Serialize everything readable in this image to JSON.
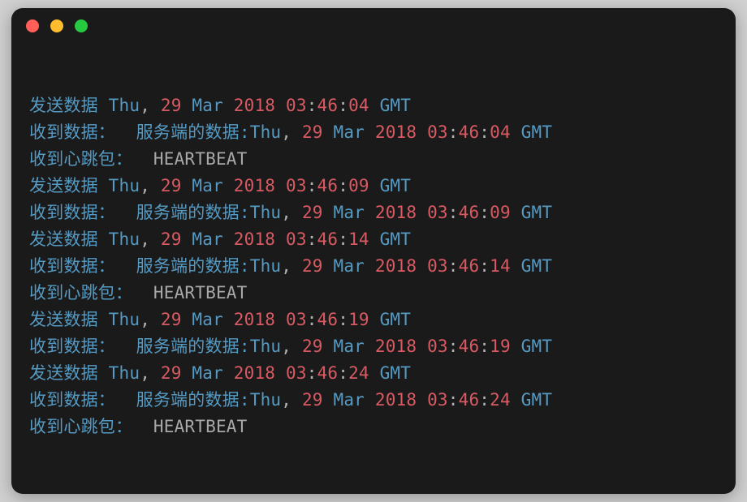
{
  "lines": [
    {
      "tokens": [
        {
          "cls": "cn",
          "text": "发送数据 "
        },
        {
          "cls": "cn",
          "text": "Thu"
        },
        {
          "cls": "punct",
          "text": ", "
        },
        {
          "cls": "num",
          "text": "29"
        },
        {
          "cls": "cn",
          "text": " Mar "
        },
        {
          "cls": "num",
          "text": "2018"
        },
        {
          "cls": "cn",
          "text": " "
        },
        {
          "cls": "num",
          "text": "03"
        },
        {
          "cls": "colon",
          "text": ":"
        },
        {
          "cls": "num",
          "text": "46"
        },
        {
          "cls": "colon",
          "text": ":"
        },
        {
          "cls": "num",
          "text": "04"
        },
        {
          "cls": "cn",
          "text": " GMT"
        }
      ]
    },
    {
      "tokens": [
        {
          "cls": "cn",
          "text": "收到数据：  服务端的数据:"
        },
        {
          "cls": "cn",
          "text": "Thu"
        },
        {
          "cls": "punct",
          "text": ", "
        },
        {
          "cls": "num",
          "text": "29"
        },
        {
          "cls": "cn",
          "text": " Mar "
        },
        {
          "cls": "num",
          "text": "2018"
        },
        {
          "cls": "cn",
          "text": " "
        },
        {
          "cls": "num",
          "text": "03"
        },
        {
          "cls": "colon",
          "text": ":"
        },
        {
          "cls": "num",
          "text": "46"
        },
        {
          "cls": "colon",
          "text": ":"
        },
        {
          "cls": "num",
          "text": "04"
        },
        {
          "cls": "cn",
          "text": " GMT"
        }
      ]
    },
    {
      "tokens": [
        {
          "cls": "cn",
          "text": "收到心跳包：  "
        },
        {
          "cls": "gray",
          "text": "HEARTBEAT"
        }
      ]
    },
    {
      "tokens": [
        {
          "cls": "cn",
          "text": "发送数据 "
        },
        {
          "cls": "cn",
          "text": "Thu"
        },
        {
          "cls": "punct",
          "text": ", "
        },
        {
          "cls": "num",
          "text": "29"
        },
        {
          "cls": "cn",
          "text": " Mar "
        },
        {
          "cls": "num",
          "text": "2018"
        },
        {
          "cls": "cn",
          "text": " "
        },
        {
          "cls": "num",
          "text": "03"
        },
        {
          "cls": "colon",
          "text": ":"
        },
        {
          "cls": "num",
          "text": "46"
        },
        {
          "cls": "colon",
          "text": ":"
        },
        {
          "cls": "num",
          "text": "09"
        },
        {
          "cls": "cn",
          "text": " GMT"
        }
      ]
    },
    {
      "tokens": [
        {
          "cls": "cn",
          "text": "收到数据：  服务端的数据:"
        },
        {
          "cls": "cn",
          "text": "Thu"
        },
        {
          "cls": "punct",
          "text": ", "
        },
        {
          "cls": "num",
          "text": "29"
        },
        {
          "cls": "cn",
          "text": " Mar "
        },
        {
          "cls": "num",
          "text": "2018"
        },
        {
          "cls": "cn",
          "text": " "
        },
        {
          "cls": "num",
          "text": "03"
        },
        {
          "cls": "colon",
          "text": ":"
        },
        {
          "cls": "num",
          "text": "46"
        },
        {
          "cls": "colon",
          "text": ":"
        },
        {
          "cls": "num",
          "text": "09"
        },
        {
          "cls": "cn",
          "text": " GMT"
        }
      ]
    },
    {
      "tokens": [
        {
          "cls": "cn",
          "text": "发送数据 "
        },
        {
          "cls": "cn",
          "text": "Thu"
        },
        {
          "cls": "punct",
          "text": ", "
        },
        {
          "cls": "num",
          "text": "29"
        },
        {
          "cls": "cn",
          "text": " Mar "
        },
        {
          "cls": "num",
          "text": "2018"
        },
        {
          "cls": "cn",
          "text": " "
        },
        {
          "cls": "num",
          "text": "03"
        },
        {
          "cls": "colon",
          "text": ":"
        },
        {
          "cls": "num",
          "text": "46"
        },
        {
          "cls": "colon",
          "text": ":"
        },
        {
          "cls": "num",
          "text": "14"
        },
        {
          "cls": "cn",
          "text": " GMT"
        }
      ]
    },
    {
      "tokens": [
        {
          "cls": "cn",
          "text": "收到数据：  服务端的数据:"
        },
        {
          "cls": "cn",
          "text": "Thu"
        },
        {
          "cls": "punct",
          "text": ", "
        },
        {
          "cls": "num",
          "text": "29"
        },
        {
          "cls": "cn",
          "text": " Mar "
        },
        {
          "cls": "num",
          "text": "2018"
        },
        {
          "cls": "cn",
          "text": " "
        },
        {
          "cls": "num",
          "text": "03"
        },
        {
          "cls": "colon",
          "text": ":"
        },
        {
          "cls": "num",
          "text": "46"
        },
        {
          "cls": "colon",
          "text": ":"
        },
        {
          "cls": "num",
          "text": "14"
        },
        {
          "cls": "cn",
          "text": " GMT"
        }
      ]
    },
    {
      "tokens": [
        {
          "cls": "cn",
          "text": "收到心跳包：  "
        },
        {
          "cls": "gray",
          "text": "HEARTBEAT"
        }
      ]
    },
    {
      "tokens": [
        {
          "cls": "cn",
          "text": "发送数据 "
        },
        {
          "cls": "cn",
          "text": "Thu"
        },
        {
          "cls": "punct",
          "text": ", "
        },
        {
          "cls": "num",
          "text": "29"
        },
        {
          "cls": "cn",
          "text": " Mar "
        },
        {
          "cls": "num",
          "text": "2018"
        },
        {
          "cls": "cn",
          "text": " "
        },
        {
          "cls": "num",
          "text": "03"
        },
        {
          "cls": "colon",
          "text": ":"
        },
        {
          "cls": "num",
          "text": "46"
        },
        {
          "cls": "colon",
          "text": ":"
        },
        {
          "cls": "num",
          "text": "19"
        },
        {
          "cls": "cn",
          "text": " GMT"
        }
      ]
    },
    {
      "tokens": [
        {
          "cls": "cn",
          "text": "收到数据：  服务端的数据:"
        },
        {
          "cls": "cn",
          "text": "Thu"
        },
        {
          "cls": "punct",
          "text": ", "
        },
        {
          "cls": "num",
          "text": "29"
        },
        {
          "cls": "cn",
          "text": " Mar "
        },
        {
          "cls": "num",
          "text": "2018"
        },
        {
          "cls": "cn",
          "text": " "
        },
        {
          "cls": "num",
          "text": "03"
        },
        {
          "cls": "colon",
          "text": ":"
        },
        {
          "cls": "num",
          "text": "46"
        },
        {
          "cls": "colon",
          "text": ":"
        },
        {
          "cls": "num",
          "text": "19"
        },
        {
          "cls": "cn",
          "text": " GMT"
        }
      ]
    },
    {
      "tokens": [
        {
          "cls": "cn",
          "text": "发送数据 "
        },
        {
          "cls": "cn",
          "text": "Thu"
        },
        {
          "cls": "punct",
          "text": ", "
        },
        {
          "cls": "num",
          "text": "29"
        },
        {
          "cls": "cn",
          "text": " Mar "
        },
        {
          "cls": "num",
          "text": "2018"
        },
        {
          "cls": "cn",
          "text": " "
        },
        {
          "cls": "num",
          "text": "03"
        },
        {
          "cls": "colon",
          "text": ":"
        },
        {
          "cls": "num",
          "text": "46"
        },
        {
          "cls": "colon",
          "text": ":"
        },
        {
          "cls": "num",
          "text": "24"
        },
        {
          "cls": "cn",
          "text": " GMT"
        }
      ]
    },
    {
      "tokens": [
        {
          "cls": "cn",
          "text": "收到数据：  服务端的数据:"
        },
        {
          "cls": "cn",
          "text": "Thu"
        },
        {
          "cls": "punct",
          "text": ", "
        },
        {
          "cls": "num",
          "text": "29"
        },
        {
          "cls": "cn",
          "text": " Mar "
        },
        {
          "cls": "num",
          "text": "2018"
        },
        {
          "cls": "cn",
          "text": " "
        },
        {
          "cls": "num",
          "text": "03"
        },
        {
          "cls": "colon",
          "text": ":"
        },
        {
          "cls": "num",
          "text": "46"
        },
        {
          "cls": "colon",
          "text": ":"
        },
        {
          "cls": "num",
          "text": "24"
        },
        {
          "cls": "cn",
          "text": " GMT"
        }
      ]
    },
    {
      "tokens": [
        {
          "cls": "cn",
          "text": "收到心跳包：  "
        },
        {
          "cls": "gray",
          "text": "HEARTBEAT"
        }
      ]
    }
  ]
}
